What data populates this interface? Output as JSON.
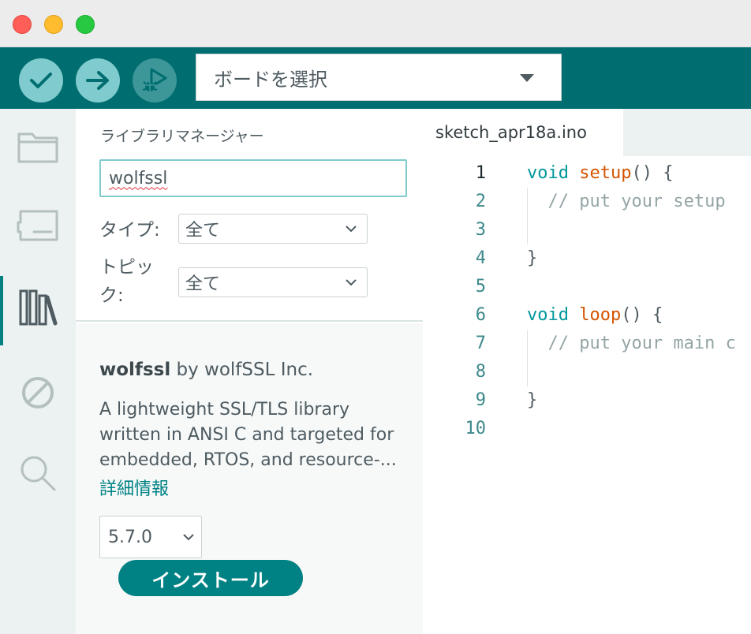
{
  "window": {
    "controls": [
      "close",
      "minimize",
      "maximize"
    ]
  },
  "toolbar": {
    "verify_icon": "checkmark-icon",
    "upload_icon": "arrow-right-icon",
    "debug_icon": "debug-icon",
    "board_select_label": "ボードを選択"
  },
  "sidebar": {
    "items": [
      {
        "icon": "folder-icon",
        "name": "sketchbook"
      },
      {
        "icon": "board-icon",
        "name": "boards-manager"
      },
      {
        "icon": "library-icon",
        "name": "library-manager",
        "active": true
      },
      {
        "icon": "debug-disabled-icon",
        "name": "debug"
      },
      {
        "icon": "search-icon",
        "name": "search"
      }
    ]
  },
  "library_manager": {
    "title": "ライブラリマネージャー",
    "search_value": "wolfssl",
    "type_label": "タイプ:",
    "type_value": "全て",
    "topic_label_line1": "トピッ",
    "topic_label_line2": "ク:",
    "topic_value": "全て",
    "result": {
      "name": "wolfssl",
      "author": " by wolfSSL Inc.",
      "description_line1": "A lightweight SSL/TLS library",
      "description_line2": "written in ANSI C and targeted for",
      "description_line3": "embedded, RTOS, and resource-...",
      "more_info_label": "詳細情報",
      "version": "5.7.0",
      "install_label": "インストール"
    }
  },
  "editor": {
    "tab_name": "sketch_apr18a.ino",
    "current_line": 1,
    "lines": [
      {
        "n": "1",
        "parts": [
          {
            "t": "void",
            "c": "kw"
          },
          {
            "t": " ",
            "c": ""
          },
          {
            "t": "setup",
            "c": "fn"
          },
          {
            "t": "() {",
            "c": ""
          }
        ]
      },
      {
        "n": "2",
        "parts": [
          {
            "t": "  // put your setup",
            "c": "cm"
          }
        ]
      },
      {
        "n": "3",
        "parts": []
      },
      {
        "n": "4",
        "parts": [
          {
            "t": "}",
            "c": ""
          }
        ]
      },
      {
        "n": "5",
        "parts": []
      },
      {
        "n": "6",
        "parts": [
          {
            "t": "void",
            "c": "kw"
          },
          {
            "t": " ",
            "c": ""
          },
          {
            "t": "loop",
            "c": "fn"
          },
          {
            "t": "() {",
            "c": ""
          }
        ]
      },
      {
        "n": "7",
        "parts": [
          {
            "t": "  // put your main c",
            "c": "cm"
          }
        ]
      },
      {
        "n": "8",
        "parts": []
      },
      {
        "n": "9",
        "parts": [
          {
            "t": "}",
            "c": ""
          }
        ]
      },
      {
        "n": "10",
        "parts": []
      }
    ]
  },
  "colors": {
    "toolbar_bg": "#006d70",
    "accent": "#008184",
    "keyword": "#00979c",
    "function": "#d35400",
    "comment": "#95a5a6"
  }
}
